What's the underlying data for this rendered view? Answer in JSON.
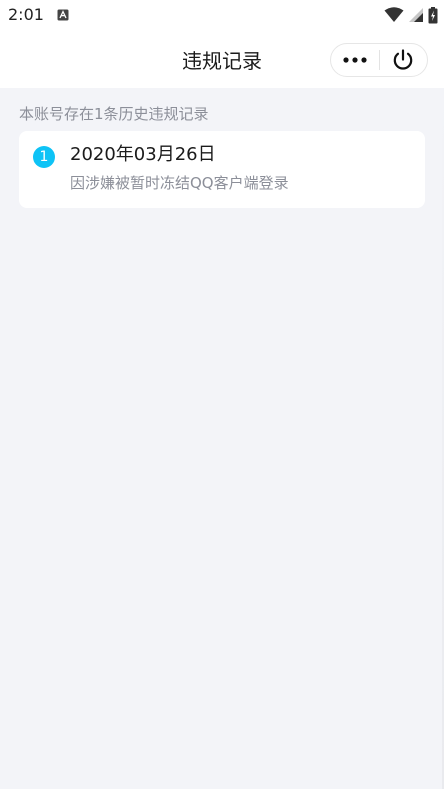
{
  "status_bar": {
    "time": "2:01",
    "icons": [
      "notification-icon",
      "wifi-icon",
      "signal-icon",
      "battery-icon"
    ]
  },
  "header": {
    "title": "违规记录",
    "capsule": {
      "more_icon": "more-dots-icon",
      "close_icon": "power-icon"
    }
  },
  "summary_text": "本账号存在1条历史违规记录",
  "records": [
    {
      "index": "1",
      "date": "2020年03月26日",
      "description": "因涉嫌被暂时冻结QQ客户端登录"
    }
  ],
  "colors": {
    "accent": "#0ec3f6",
    "background": "#f3f4f8",
    "card": "#ffffff",
    "secondary_text": "#8c8f99",
    "primary_text": "#1b1b1b"
  }
}
